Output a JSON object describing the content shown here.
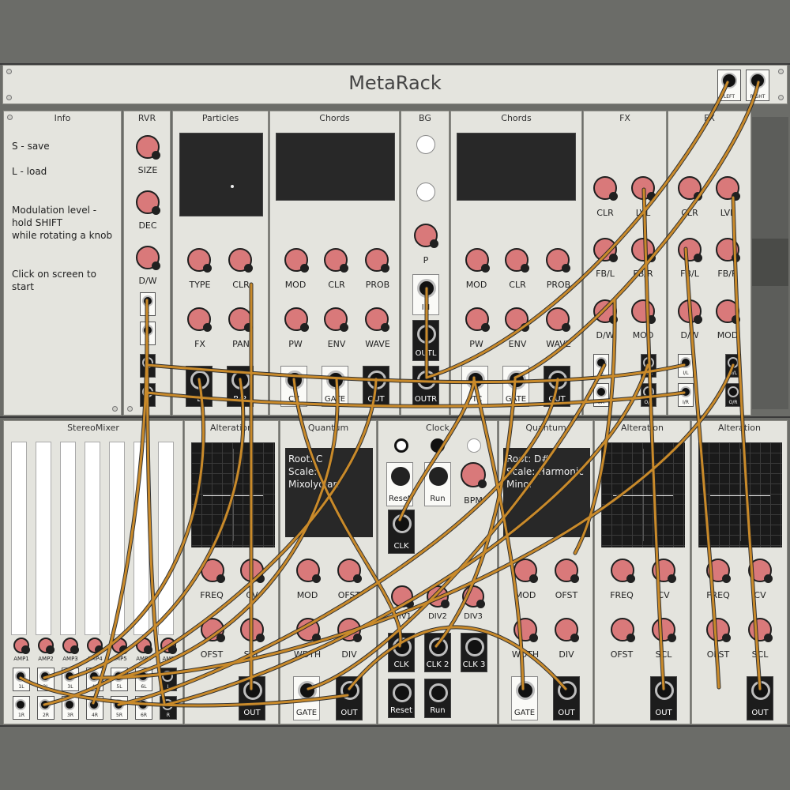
{
  "app": {
    "title": "MetaRack"
  },
  "header_outputs": [
    "LEFT",
    "RIGHT"
  ],
  "info": {
    "title": "Info",
    "lines": [
      "S - save",
      "L - load",
      "Modulation level -",
      "hold SHIFT",
      "while rotating a knob",
      "Click on screen to start"
    ]
  },
  "rvr": {
    "title": "RVR",
    "knobs": [
      "SIZE",
      "DEC",
      "D/W"
    ],
    "jacks": [
      "L",
      "R",
      "L",
      "R"
    ]
  },
  "particles": {
    "title": "Particles",
    "knobs": [
      "TYPE",
      "CLR",
      "FX",
      "PAN"
    ],
    "jacks": [
      "L",
      "R/R"
    ]
  },
  "chords1": {
    "title": "Chords",
    "knobs": [
      "MOD",
      "CLR",
      "PROB",
      "PW",
      "ENV",
      "WAVE"
    ],
    "jacks": [
      "CV",
      "GATE",
      "OUT"
    ]
  },
  "bg": {
    "title": "BG",
    "knobs": [
      "P"
    ],
    "jacks": [
      "IN",
      "OUTL",
      "OUTR"
    ]
  },
  "chords2": {
    "title": "Chords",
    "knobs": [
      "MOD",
      "CLR",
      "PROB",
      "PW",
      "ENV",
      "WAVE"
    ],
    "jacks": [
      "PTC",
      "GATE",
      "OUT"
    ]
  },
  "fx1": {
    "title": "FX",
    "knobs": [
      "CLR",
      "LVL",
      "FB/L",
      "FB/R",
      "D/W",
      "MOD"
    ],
    "jacks": [
      "I/L",
      "I/R",
      "O/L",
      "O/R"
    ]
  },
  "fx2": {
    "title": "FX",
    "knobs": [
      "CLR",
      "LVL",
      "FB/L",
      "FB/R",
      "D/W",
      "MOD"
    ],
    "jacks": [
      "I/L",
      "I/R",
      "O/L",
      "O/R"
    ]
  },
  "stereomixer": {
    "title": "StereoMixer",
    "amps": [
      "AMP1",
      "AMP2",
      "AMP3",
      "AMP4",
      "AMP5",
      "AMP6",
      "AMP"
    ],
    "left_jacks": [
      "1L",
      "2L",
      "3L",
      "4L",
      "5L",
      "6L",
      "L"
    ],
    "right_jacks": [
      "1R",
      "2R",
      "3R",
      "4R",
      "5R",
      "6R",
      "R"
    ]
  },
  "alteration1": {
    "title": "Alteration",
    "knobs": [
      "FREQ",
      "CV",
      "OFST",
      "SCL"
    ],
    "jacks": [
      "OUT"
    ]
  },
  "quantum1": {
    "title": "Quantum",
    "root": "Root: C",
    "scale": "Scale: Mixolydian",
    "knobs": [
      "MOD",
      "OFST",
      "WDTH",
      "DIV"
    ],
    "jacks": [
      "GATE",
      "OUT"
    ]
  },
  "clock": {
    "title": "Clock",
    "buttons": [
      "Reset",
      "Run"
    ],
    "knobs": [
      "BPM",
      "DIV1",
      "DIV2",
      "DIV3"
    ],
    "jacks": [
      "CLK",
      "CLK",
      "CLK 2",
      "CLK 3",
      "Reset",
      "Run"
    ]
  },
  "quantum2": {
    "title": "Quantum",
    "root": "Root: D#",
    "scale": "Scale: Harmonic",
    "scale2": "Minor",
    "knobs": [
      "MOD",
      "OFST",
      "WDTH",
      "DIV"
    ],
    "jacks": [
      "GATE",
      "OUT"
    ]
  },
  "alteration2": {
    "title": "Alteration",
    "knobs": [
      "FREQ",
      "CV",
      "OFST",
      "SCL"
    ],
    "jacks": [
      "OUT"
    ]
  },
  "alteration3": {
    "title": "Alteration",
    "knobs": [
      "FREQ",
      "CV",
      "OFST",
      "SCL"
    ],
    "jacks": [
      "OUT"
    ]
  },
  "colors": {
    "knob": "#d9797a",
    "cable": "#c98a2a",
    "panel": "#e4e4de",
    "background": "#6b6c68"
  }
}
